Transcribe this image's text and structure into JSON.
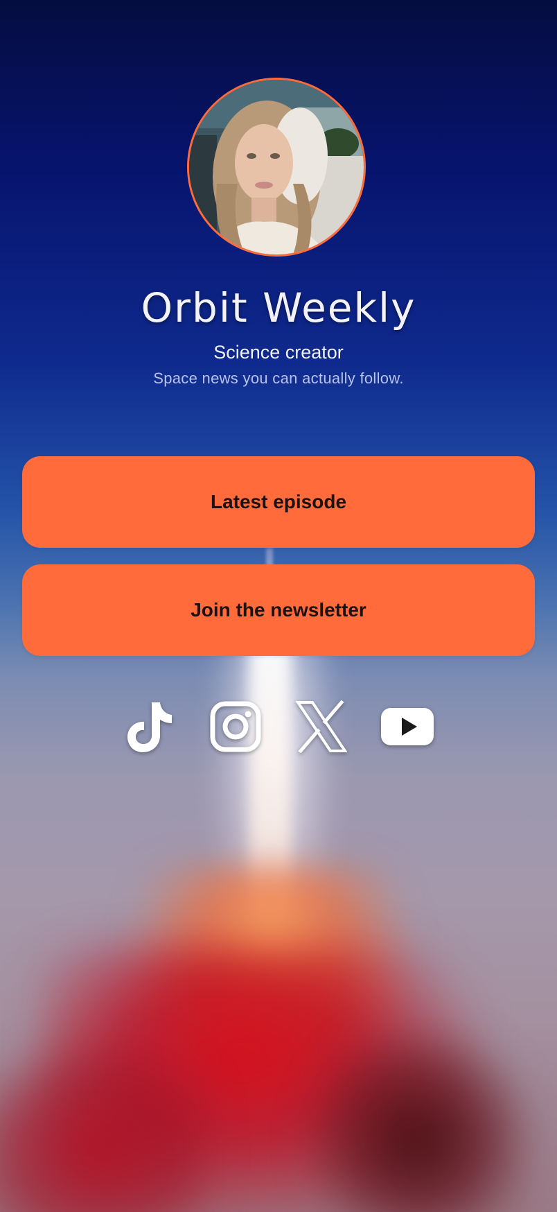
{
  "profile": {
    "name": "Orbit Weekly",
    "category": "Science creator",
    "bio": "Space news you can actually follow.",
    "avatar_icon": "profile-photo"
  },
  "links": [
    {
      "label": "Latest episode"
    },
    {
      "label": "Join the newsletter"
    }
  ],
  "socials": [
    {
      "icon": "tiktok-icon"
    },
    {
      "icon": "instagram-icon"
    },
    {
      "icon": "x-icon"
    },
    {
      "icon": "youtube-icon"
    }
  ],
  "colors": {
    "accent": "#ff6b3b",
    "button_text": "#1d1210",
    "background_top": "#050d3f",
    "avatar_ring": "#ff6a3a"
  }
}
